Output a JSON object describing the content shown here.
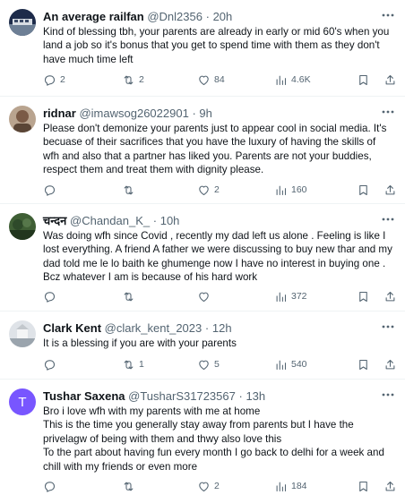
{
  "tweets": [
    {
      "name": "An average railfan",
      "handle": "@Dnl2356",
      "time": "20h",
      "body": [
        "Kind of blessing tbh, your parents are already in early or mid 60's when you land a job so it's bonus that you get to spend time with them as they don't have much time left"
      ],
      "replies": "2",
      "retweets": "2",
      "likes": "84",
      "views": "4.6K",
      "avatar_color": "#1d2b4a"
    },
    {
      "name": "ridnar",
      "handle": "@imawsog26022901",
      "time": "9h",
      "body": [
        "Please don't demonize your parents just to appear cool in social media. It's becuase of their sacrifices that you have the luxury of having the skills of wfh and also that a partner has liked you. Parents are not your buddies, respect them and treat them with dignity please."
      ],
      "replies": "",
      "retweets": "",
      "likes": "2",
      "views": "160",
      "avatar_color": "#7a5a46"
    },
    {
      "name": "चन्दन",
      "handle": "@Chandan_K_",
      "time": "10h",
      "body": [
        "Was doing wfh since Covid , recently my dad left us alone . Feeling is like I lost everything. A friend A father we were discussing to buy new  thar and my dad told me le lo baith ke ghumenge now I have no interest in buying one . Bcz whatever I am is  because of his hard work"
      ],
      "replies": "",
      "retweets": "",
      "likes": "",
      "views": "372",
      "avatar_color": "#2e4a2a"
    },
    {
      "name": "Clark Kent",
      "handle": "@clark_kent_2023",
      "time": "12h",
      "body": [
        "It is a blessing if you are with your parents"
      ],
      "replies": "",
      "retweets": "1",
      "likes": "5",
      "views": "540",
      "avatar_color": "#c9ccd0"
    },
    {
      "name": "Tushar Saxena",
      "handle": "@TusharS31723567",
      "time": "13h",
      "avatar_letter": "T",
      "body": [
        "Bro i love wfh with my parents with me at home",
        "This is the time you generally stay away from parents but I have the privelagw of being with them and thwy also love this",
        "To the part about having fun every month I go back to delhi for a week and chill with my friends or even more"
      ],
      "replies": "",
      "retweets": "",
      "likes": "2",
      "views": "184",
      "avatar_color": "#7856ff"
    }
  ],
  "icons": {
    "more": "more-horizontal-icon",
    "reply": "reply-icon",
    "retweet": "retweet-icon",
    "like": "heart-icon",
    "views": "views-icon",
    "bookmark": "bookmark-icon",
    "share": "share-icon"
  }
}
